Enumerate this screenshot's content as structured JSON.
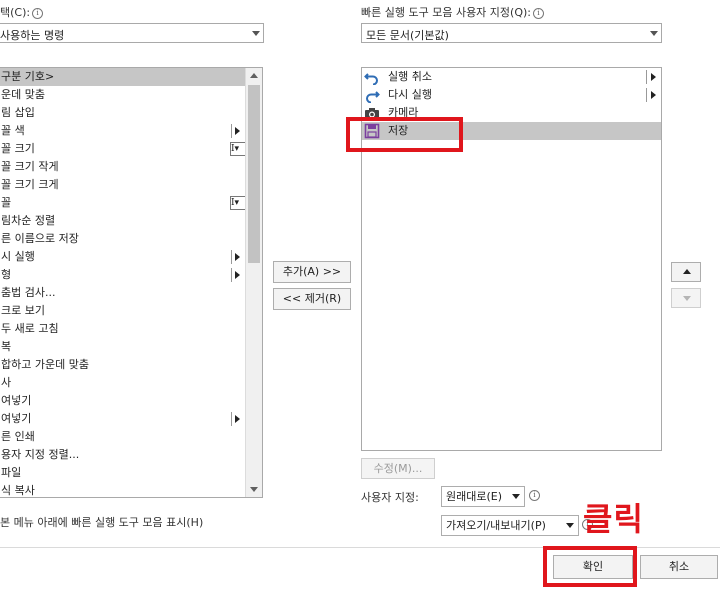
{
  "left_panel": {
    "choose_label": "택(C):",
    "choose_value": "사용하는 명령",
    "items": [
      {
        "label": "구분 기호>",
        "selected": true,
        "submenu": false,
        "picker": false
      },
      {
        "label": "운데 맞춤",
        "selected": false,
        "submenu": false,
        "picker": false
      },
      {
        "label": "림 삽입",
        "selected": false,
        "submenu": false,
        "picker": false
      },
      {
        "label": "꼴 색",
        "selected": false,
        "submenu": true,
        "picker": false
      },
      {
        "label": "꼴 크기",
        "selected": false,
        "submenu": false,
        "picker": true
      },
      {
        "label": "꼴 크기 작게",
        "selected": false,
        "submenu": false,
        "picker": false
      },
      {
        "label": "꼴 크기 크게",
        "selected": false,
        "submenu": false,
        "picker": false
      },
      {
        "label": "꼴",
        "selected": false,
        "submenu": false,
        "picker": true
      },
      {
        "label": "림차순 정렬",
        "selected": false,
        "submenu": false,
        "picker": false
      },
      {
        "label": "른 이름으로 저장",
        "selected": false,
        "submenu": false,
        "picker": false
      },
      {
        "label": "시 실행",
        "selected": false,
        "submenu": true,
        "picker": false
      },
      {
        "label": "형",
        "selected": false,
        "submenu": true,
        "picker": false
      },
      {
        "label": "춤법 검사...",
        "selected": false,
        "submenu": false,
        "picker": false
      },
      {
        "label": "크로 보기",
        "selected": false,
        "submenu": false,
        "picker": false
      },
      {
        "label": "두 새로 고침",
        "selected": false,
        "submenu": false,
        "picker": false
      },
      {
        "label": "복",
        "selected": false,
        "submenu": false,
        "picker": false
      },
      {
        "label": "합하고 가운데 맞춤",
        "selected": false,
        "submenu": false,
        "picker": false
      },
      {
        "label": "사",
        "selected": false,
        "submenu": false,
        "picker": false
      },
      {
        "label": "여넣기",
        "selected": false,
        "submenu": false,
        "picker": false
      },
      {
        "label": "여넣기",
        "selected": false,
        "submenu": true,
        "picker": false
      },
      {
        "label": "른 인쇄",
        "selected": false,
        "submenu": false,
        "picker": false
      },
      {
        "label": "용자 지정 정렬...",
        "selected": false,
        "submenu": false,
        "picker": false
      },
      {
        "label": " 파일",
        "selected": false,
        "submenu": false,
        "picker": false
      },
      {
        "label": "식 복사",
        "selected": false,
        "submenu": false,
        "picker": false
      }
    ],
    "show_below_label": "본 메뉴 아래에 빠른 실행 도구 모음 표시(H)"
  },
  "middle": {
    "add_label": "추가(A) >>",
    "remove_label": "<< 제거(R)"
  },
  "right_panel": {
    "customize_label": "빠른 실행 도구 모음 사용자 지정(Q):",
    "customize_value": "모든 문서(기본값)",
    "items": [
      {
        "label": "실행 취소",
        "icon": "undo-icon",
        "selected": false,
        "submenu": true
      },
      {
        "label": "다시 실행",
        "icon": "redo-icon",
        "selected": false,
        "submenu": true
      },
      {
        "label": "카메라",
        "icon": "camera-icon",
        "selected": false,
        "submenu": false
      },
      {
        "label": "저장",
        "icon": "save-icon",
        "selected": true,
        "submenu": false
      }
    ],
    "modify_label": "수정(M)...",
    "user_custom_label": "사용자 지정:",
    "reset_label": "원래대로(E)",
    "import_export_label": "가져오기/내보내기(P)"
  },
  "footer": {
    "ok_label": "확인",
    "cancel_label": "취소"
  },
  "annotation": {
    "text": "클릭",
    "color": "#e0161c"
  },
  "colors": {
    "selection": "#c6c6c6",
    "save_icon": "#7b3f9e",
    "undo_icon": "#2f6db5"
  }
}
